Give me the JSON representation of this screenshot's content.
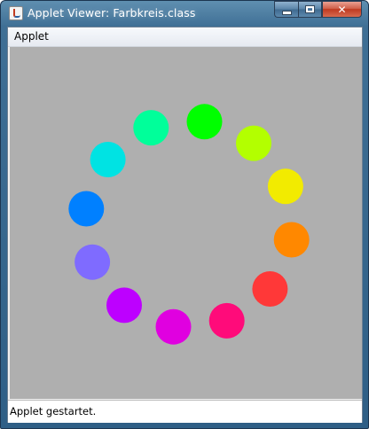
{
  "window": {
    "title": "Applet Viewer: Farbkreis.class",
    "icon": "java-icon",
    "controls": {
      "minimize_icon": "minimize-icon",
      "maximize_icon": "maximize-icon",
      "close_icon": "close-icon",
      "close_glyph": "✕"
    }
  },
  "menubar": {
    "items": [
      {
        "label": "Applet"
      }
    ]
  },
  "canvas": {
    "background": "#afafaf",
    "circles": [
      {
        "color": "#00ff00"
      },
      {
        "color": "#b3ff00"
      },
      {
        "color": "#f2eb00"
      },
      {
        "color": "#ff8800"
      },
      {
        "color": "#ff3838"
      },
      {
        "color": "#ff0b7a"
      },
      {
        "color": "#e000e0"
      },
      {
        "color": "#bd00ff"
      },
      {
        "color": "#7f6bff"
      },
      {
        "color": "#0080ff"
      },
      {
        "color": "#00e3e3"
      },
      {
        "color": "#00ff9a"
      }
    ]
  },
  "status": {
    "text": "Applet gestartet."
  }
}
